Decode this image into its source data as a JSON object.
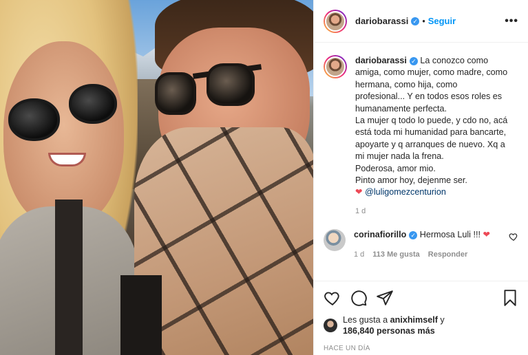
{
  "post": {
    "username": "dariobarassi",
    "follow_label": "Seguir",
    "separator": "•",
    "more_label": "•••",
    "caption_lines": [
      "La conozco como",
      "amiga, como mujer, como madre, como",
      "hermana, como hija, como",
      "profesional... Y en todos esos roles es",
      "humanamente perfecta.",
      "La mujer q todo lo puede, y cdo no, acá",
      "está toda mi humanidad para bancarte,",
      "apoyarte y q arranques de nuevo. Xq a",
      "mi mujer nada la frena.",
      "Poderosa, amor mio.",
      "Pinto amor hoy, dejenme ser."
    ],
    "caption_mention": "@luligomezcenturion",
    "caption_age": "1 d"
  },
  "comment": {
    "username": "corinafiorillo",
    "text": "Hermosa Luli !!!",
    "age": "1 d",
    "likes": "113 Me gusta",
    "reply_label": "Responder"
  },
  "likes": {
    "prefix": "Les gusta a",
    "first_user": "anixhimself",
    "joiner": "y",
    "others": "186,840 personas más"
  },
  "timestamp": "HACE UN DÍA",
  "colors": {
    "follow": "#0095f6",
    "verified": "#3897f0",
    "heart": "#ed4956",
    "muted": "#8e8e8e"
  },
  "icons": [
    "verified-icon",
    "heart-icon",
    "comment-icon",
    "share-icon",
    "bookmark-icon",
    "more-icon"
  ]
}
